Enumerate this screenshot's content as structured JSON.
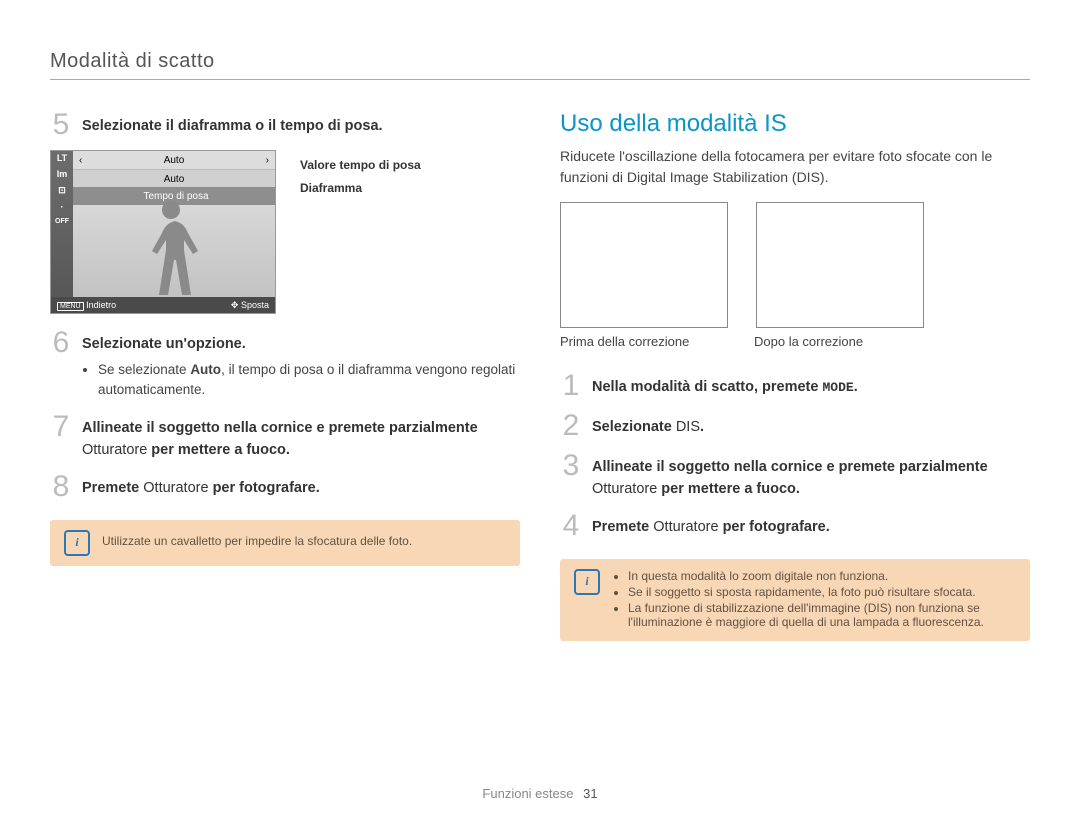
{
  "header": {
    "title": "Modalità di scatto"
  },
  "left": {
    "step5": {
      "text": "Selezionate il diaframma o il tempo di posa."
    },
    "lcd": {
      "left_icons": [
        "LT",
        "Im",
        "⊡",
        "·",
        "OFF"
      ],
      "row1_left": "‹",
      "row1": "Auto",
      "row1_right": "›",
      "row2": "Auto",
      "label": "Tempo di posa",
      "bottom_left_label": "MENU",
      "bottom_left_text": "Indietro",
      "bottom_right_icon": "✥",
      "bottom_right_text": "Sposta"
    },
    "lcd_legend": {
      "line1": "Valore tempo di posa",
      "line2": "Diaframma"
    },
    "step6": {
      "title": "Selezionate un'opzione.",
      "bullet_pre": "Se selezionate ",
      "bullet_strong": "Auto",
      "bullet_post": ", il tempo di posa o il diaframma vengono regolati automaticamente."
    },
    "step7": {
      "strong1": "Allineate il soggetto nella cornice e premete parzialmente ",
      "plain": "Otturatore",
      "strong2": " per mettere a fuoco."
    },
    "step8": {
      "strong1": "Premete ",
      "plain": "Otturatore",
      "strong2": " per fotografare."
    },
    "note": "Utilizzate un cavalletto per impedire la sfocatura delle foto."
  },
  "right": {
    "title": "Uso della modalità IS",
    "desc": "Riducete l'oscillazione della fotocamera per evitare foto sfocate con le funzioni di Digital Image Stabilization (DIS).",
    "cap1": "Prima della correzione",
    "cap2": "Dopo la correzione",
    "step1": {
      "strong1": "Nella modalità di scatto, premete ",
      "mode": "MODE",
      "strong2": "."
    },
    "step2": {
      "strong1": "Selezionate ",
      "plain": "DIS",
      "strong2": "."
    },
    "step3": {
      "strong1": "Allineate il soggetto nella cornice e premete parzialmente ",
      "plain": "Otturatore",
      "strong2": " per mettere a fuoco."
    },
    "step4": {
      "strong1": "Premete ",
      "plain": "Otturatore",
      "strong2": " per fotografare."
    },
    "note": {
      "items": [
        "In questa modalità lo zoom digitale non funziona.",
        "Se il soggetto si sposta rapidamente, la foto può risultare sfocata.",
        "La funzione di stabilizzazione dell'immagine (DIS) non funziona se l'illuminazione è maggiore di quella di una lampada a fluorescenza."
      ]
    }
  },
  "footer": {
    "section": "Funzioni estese",
    "page": "31"
  }
}
